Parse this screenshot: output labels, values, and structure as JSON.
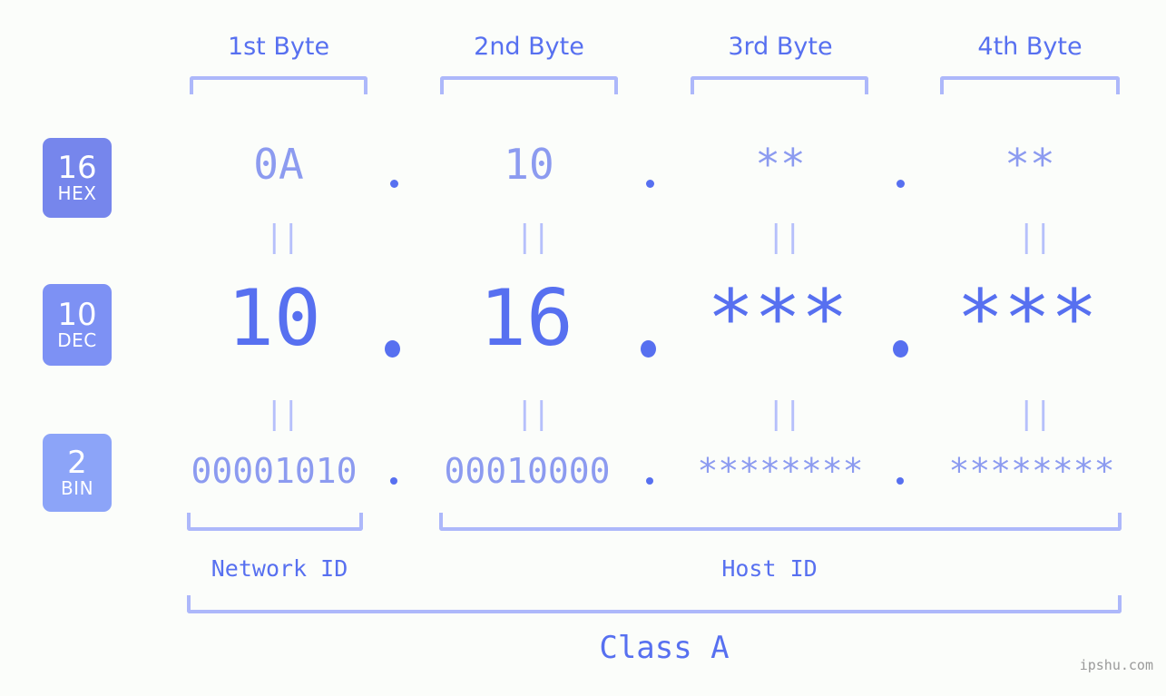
{
  "meta": {
    "background_color": "#fbfdfa",
    "accent_strong": "#5770f0",
    "accent_light": "#8c9bf0",
    "accent_pale": "#adb8fa",
    "badge_hex_color": "#7686ec",
    "badge_dec_color": "#7d91f4",
    "badge_bin_color": "#8ca4f8"
  },
  "headers": [
    {
      "label": "1st Byte"
    },
    {
      "label": "2nd Byte"
    },
    {
      "label": "3rd Byte"
    },
    {
      "label": "4th Byte"
    }
  ],
  "rows": [
    {
      "badge_number": "16",
      "badge_name": "HEX",
      "values": [
        "0A",
        "10",
        "**",
        "**"
      ],
      "separator": "."
    },
    {
      "badge_number": "10",
      "badge_name": "DEC",
      "values": [
        "10",
        "16",
        "***",
        "***"
      ],
      "separator": "."
    },
    {
      "badge_number": "2",
      "badge_name": "BIN",
      "values": [
        "00001010",
        "00010000",
        "********",
        "********"
      ],
      "separator": "."
    }
  ],
  "equality_marker": "||",
  "sections": [
    {
      "label": "Network ID"
    },
    {
      "label": "Host ID"
    }
  ],
  "class": {
    "label": "Class A"
  },
  "watermark": {
    "text": "ipshu.com"
  }
}
